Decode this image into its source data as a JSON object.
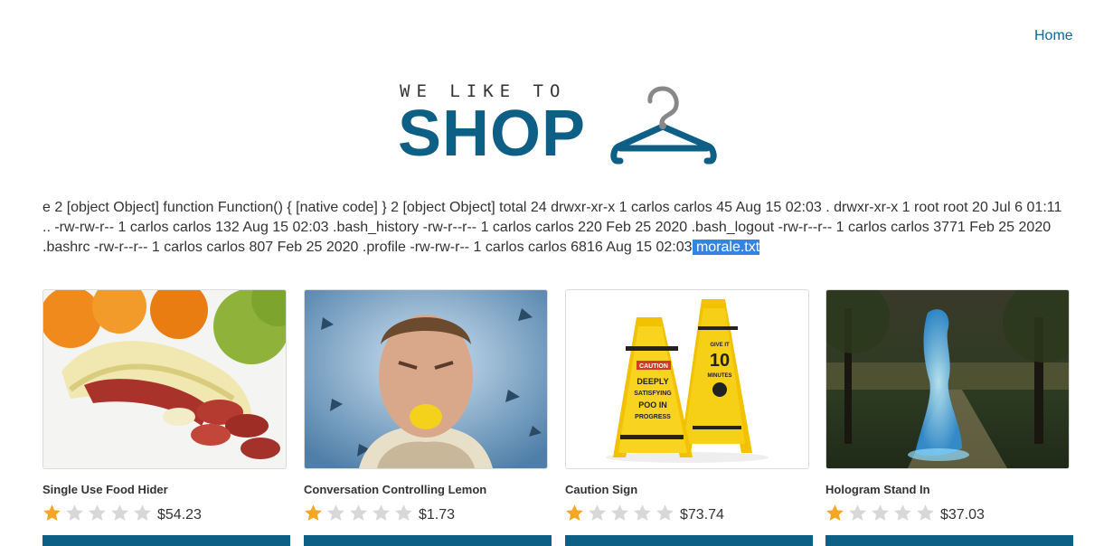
{
  "nav": {
    "home_label": "Home"
  },
  "logo": {
    "tagline": "WE LIKE TO",
    "word": "SHOP",
    "hanger_icon": "hanger-icon"
  },
  "output": {
    "text": "e 2 [object Object] function Function() { [native code] } 2 [object Object] total 24 drwxr-xr-x 1 carlos carlos 45 Aug 15 02:03 . drwxr-xr-x 1 root root 20 Jul 6 01:11 .. -rw-rw-r-- 1 carlos carlos 132 Aug 15 02:03 .bash_history -rw-r--r-- 1 carlos carlos 220 Feb 25 2020 .bash_logout -rw-r--r-- 1 carlos carlos 3771 Feb 25 2020 .bashrc -rw-r--r-- 1 carlos carlos 807 Feb 25 2020 .profile -rw-rw-r-- 1 carlos carlos 6816 Aug 15 02:03",
    "selected": " morale.txt "
  },
  "products": [
    {
      "name": "Single Use Food Hider",
      "price": "$54.23",
      "rating": 1
    },
    {
      "name": "Conversation Controlling Lemon",
      "price": "$1.73",
      "rating": 1
    },
    {
      "name": "Caution Sign",
      "price": "$73.74",
      "rating": 1
    },
    {
      "name": "Hologram Stand In",
      "price": "$37.03",
      "rating": 1
    }
  ],
  "sign_text": {
    "left": [
      "CAUTION",
      "DEEPLY",
      "SATISFYING",
      "POO IN",
      "PROGRESS"
    ],
    "right": [
      "GIVE IT",
      "10",
      "MINUTES"
    ]
  },
  "colors": {
    "accent": "#0e5f86",
    "link": "#0a6a9a",
    "star_on": "#f5a623",
    "star_off": "#d8d8d8",
    "selection": "#3584e4"
  }
}
